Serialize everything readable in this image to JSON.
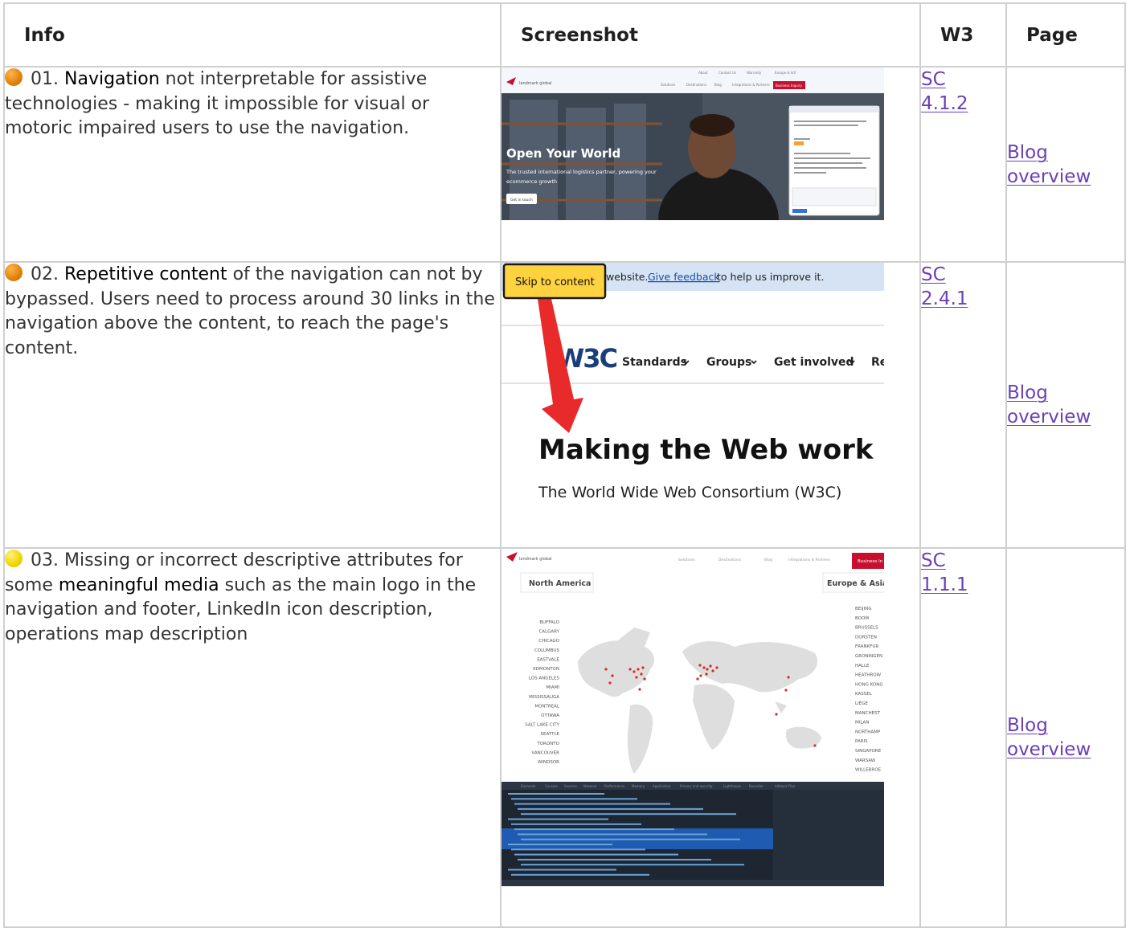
{
  "header": {
    "info": "Info",
    "screenshot": "Screenshot",
    "w3": "W3",
    "page": "Page"
  },
  "rows": [
    {
      "dot_color": "#e8890f",
      "number": "01.",
      "keyword": "Navigation",
      "text": " not interpretable for assistive technologies - making it impossible for visual or motoric impaired users to use the navigation.",
      "sc_label": "SC",
      "sc_num": "4.1.2",
      "page_line1": "Blog",
      "page_line2": "overview",
      "shot": {
        "headline": "Open Your World",
        "sub1": "The trusted international logistics partner, powering your",
        "sub2": "ecommerce growth",
        "cta": "Get in touch",
        "nav_button": "Business Inquiry"
      }
    },
    {
      "dot_color": "#e8890f",
      "number": "02.",
      "keyword": "Repetitive content",
      "text": " of the navigation can not by bypassed. Users need to process around 30 links in the navigation above the content, to reach the page's content.",
      "sc_label": "SC",
      "sc_num": "2.4.1",
      "page_line1": "Blog",
      "page_line2": "overview",
      "shot": {
        "skip": "Skip to content",
        "banner_pre": "website.",
        "banner_link": "Give feedback",
        "banner_post": "to help us improve it.",
        "logo": "W3C",
        "nav1": "Standards",
        "nav2": "Groups",
        "nav3": "Get involved",
        "nav4": "Re",
        "title": "Making the Web work",
        "subtitle": "The World Wide Web Consortium (W3C)"
      }
    },
    {
      "dot_color": "#f5d000",
      "number": "03.",
      "keyword": "meaningful media",
      "text_pre": " Missing or incorrect descriptive attributes for some ",
      "text": " such as the main logo in the navigation and footer, LinkedIn icon description, operations map description",
      "sc_label": "SC",
      "sc_num": "1.1.1",
      "page_line1": "Blog",
      "page_line2": "overview",
      "shot": {
        "left_title": "North America",
        "right_title": "Europe & Asia",
        "nav_button": "Business In",
        "left_cities": [
          "BUFFALO",
          "CALGARY",
          "CHICAGO",
          "COLUMBUS",
          "EASTVALE",
          "EDMONTON",
          "LOS ANGELES",
          "MIAMI",
          "MISSISSAUGA",
          "MONTREAL",
          "OTTAWA",
          "SALT LAKE CITY",
          "SEATTLE",
          "TORONTO",
          "VANCOUVER",
          "WINDSOR"
        ],
        "right_cities": [
          "BEIJING",
          "BOOM",
          "BRUSSELS",
          "DORSTEN",
          "FRANKFUR",
          "GRONINGEN",
          "HALLE",
          "HEATHROW",
          "HONG KONG",
          "KASSEL",
          "LIÈGE",
          "MANCHEST",
          "MILAN",
          "NORTHAMP",
          "PARIS",
          "SINGAPORE",
          "WARSAW",
          "WILLEBROE"
        ]
      }
    }
  ]
}
